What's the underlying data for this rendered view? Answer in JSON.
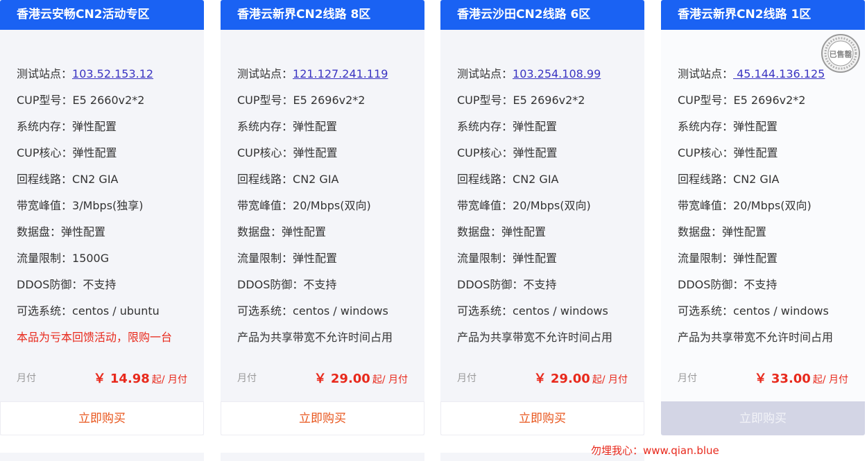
{
  "products": [
    {
      "title": "香港云安畅CN2活动专区",
      "specs": [
        {
          "label": "测试站点：",
          "value": "103.52.153.12",
          "link": true
        },
        {
          "label": "CUP型号：",
          "value": "E5 2660v2*2"
        },
        {
          "label": "系统内存：",
          "value": "弹性配置"
        },
        {
          "label": "CUP核心：",
          "value": "弹性配置"
        },
        {
          "label": "回程线路：",
          "value": "CN2 GIA"
        },
        {
          "label": "带宽峰值：",
          "value": "3/Mbps(独享)"
        },
        {
          "label": "数据盘：",
          "value": "弹性配置"
        },
        {
          "label": "流量限制：",
          "value": "1500G"
        },
        {
          "label": "DDOS防御：",
          "value": "不支持"
        },
        {
          "label": "可选系统：",
          "value": "centos / ubuntu"
        }
      ],
      "note": "本品为亏本回馈活动，限购一台",
      "note_color": "#e8291c",
      "cycle": "月付",
      "price": "￥ 14.98",
      "price_unit": "起/ 月付",
      "buy_label": "立即购买",
      "sold_out": false
    },
    {
      "title": "香港云新界CN2线路 8区",
      "specs": [
        {
          "label": "测试站点：",
          "value": "121.127.241.119",
          "link": true
        },
        {
          "label": "CUP型号：",
          "value": "E5 2696v2*2"
        },
        {
          "label": "系统内存：",
          "value": "弹性配置"
        },
        {
          "label": "CUP核心：",
          "value": "弹性配置"
        },
        {
          "label": "回程线路：",
          "value": "CN2 GIA"
        },
        {
          "label": "带宽峰值：",
          "value": "20/Mbps(双向)"
        },
        {
          "label": "数据盘：",
          "value": "弹性配置"
        },
        {
          "label": "流量限制：",
          "value": "弹性配置"
        },
        {
          "label": "DDOS防御：",
          "value": "不支持"
        },
        {
          "label": "可选系统：",
          "value": "centos / windows"
        }
      ],
      "note": "产品为共享带宽不允许时间占用",
      "note_color": "#333333",
      "cycle": "月付",
      "price": "￥ 29.00",
      "price_unit": "起/ 月付",
      "buy_label": "立即购买",
      "sold_out": false
    },
    {
      "title": "香港云沙田CN2线路 6区",
      "specs": [
        {
          "label": "测试站点：",
          "value": "103.254.108.99",
          "link": true
        },
        {
          "label": "CUP型号：",
          "value": "E5 2696v2*2"
        },
        {
          "label": "系统内存：",
          "value": "弹性配置"
        },
        {
          "label": "CUP核心：",
          "value": "弹性配置"
        },
        {
          "label": "回程线路：",
          "value": "CN2 GIA"
        },
        {
          "label": "带宽峰值：",
          "value": "20/Mbps(双向)"
        },
        {
          "label": "数据盘：",
          "value": "弹性配置"
        },
        {
          "label": "流量限制：",
          "value": "弹性配置"
        },
        {
          "label": "DDOS防御：",
          "value": "不支持"
        },
        {
          "label": "可选系统：",
          "value": "centos / windows"
        }
      ],
      "note": "产品为共享带宽不允许时间占用",
      "note_color": "#333333",
      "cycle": "月付",
      "price": "￥ 29.00",
      "price_unit": "起/ 月付",
      "buy_label": "立即购买",
      "sold_out": false
    },
    {
      "title": "香港云新界CN2线路 1区",
      "specs": [
        {
          "label": "测试站点：",
          "value": " 45.144.136.125",
          "link": true
        },
        {
          "label": "CUP型号：",
          "value": "E5 2696v2*2"
        },
        {
          "label": "系统内存：",
          "value": "弹性配置"
        },
        {
          "label": "CUP核心：",
          "value": "弹性配置"
        },
        {
          "label": "回程线路：",
          "value": "CN2 GIA"
        },
        {
          "label": "带宽峰值：",
          "value": "20/Mbps(双向)"
        },
        {
          "label": "数据盘：",
          "value": "弹性配置"
        },
        {
          "label": "流量限制：",
          "value": "弹性配置"
        },
        {
          "label": "DDOS防御：",
          "value": "不支持"
        },
        {
          "label": "可选系统：",
          "value": "centos / windows"
        }
      ],
      "note": "产品为共享带宽不允许时间占用",
      "note_color": "#333333",
      "cycle": "月付",
      "price": "￥ 33.00",
      "price_unit": "起/ 月付",
      "buy_label": "立即购买",
      "sold_out": true,
      "sold_stamp_text": "已售罄"
    }
  ],
  "watermark": "勿埋我心：www.qian.blue",
  "colors": {
    "header_blue": "#1a62f3",
    "price_red": "#e8291c",
    "buy_orange": "#e8551c",
    "card_bg": "#f4f5f9",
    "disabled_bg": "#d3d5e5",
    "link": "#3a34c2"
  }
}
